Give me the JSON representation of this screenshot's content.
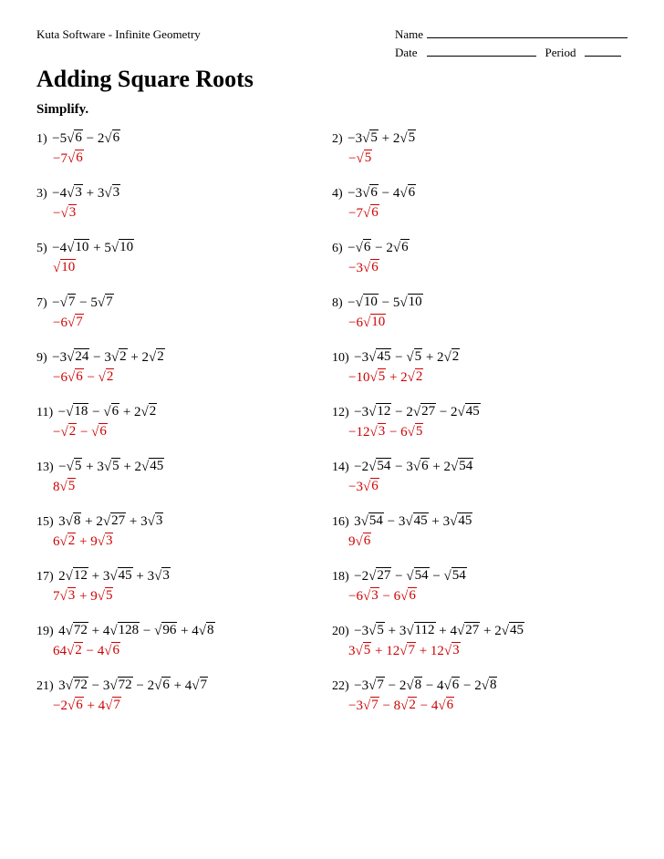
{
  "header": {
    "software": "Kuta Software - Infinite Geometry",
    "name_label": "Name",
    "date_label": "Date",
    "period_label": "Period"
  },
  "title": "Adding Square Roots",
  "instruction": "Simplify.",
  "problems": [
    {
      "num": "1)",
      "expr_html": "&minus;5&radic;<span class='rad-content'>6</span> &minus; 2&radic;<span class='rad-content'>6</span>",
      "answer_html": "&minus;7&radic;<span class='rad-content'>6</span>"
    },
    {
      "num": "2)",
      "expr_html": "&minus;3&radic;<span class='rad-content'>5</span> + 2&radic;<span class='rad-content'>5</span>",
      "answer_html": "&minus;&radic;<span class='rad-content'>5</span>"
    },
    {
      "num": "3)",
      "expr_html": "&minus;4&radic;<span class='rad-content'>3</span> + 3&radic;<span class='rad-content'>3</span>",
      "answer_html": "&minus;&radic;<span class='rad-content'>3</span>"
    },
    {
      "num": "4)",
      "expr_html": "&minus;3&radic;<span class='rad-content'>6</span> &minus; 4&radic;<span class='rad-content'>6</span>",
      "answer_html": "&minus;7&radic;<span class='rad-content'>6</span>"
    },
    {
      "num": "5)",
      "expr_html": "&minus;4&radic;<span class='rad-content'>10</span> + 5&radic;<span class='rad-content'>10</span>",
      "answer_html": "&radic;<span class='rad-content'>10</span>"
    },
    {
      "num": "6)",
      "expr_html": "&minus;&radic;<span class='rad-content'>6</span> &minus; 2&radic;<span class='rad-content'>6</span>",
      "answer_html": "&minus;3&radic;<span class='rad-content'>6</span>"
    },
    {
      "num": "7)",
      "expr_html": "&minus;&radic;<span class='rad-content'>7</span> &minus; 5&radic;<span class='rad-content'>7</span>",
      "answer_html": "&minus;6&radic;<span class='rad-content'>7</span>"
    },
    {
      "num": "8)",
      "expr_html": "&minus;&radic;<span class='rad-content'>10</span> &minus; 5&radic;<span class='rad-content'>10</span>",
      "answer_html": "&minus;6&radic;<span class='rad-content'>10</span>"
    },
    {
      "num": "9)",
      "expr_html": "&minus;3&radic;<span class='rad-content'>24</span> &minus; 3&radic;<span class='rad-content'>2</span> + 2&radic;<span class='rad-content'>2</span>",
      "answer_html": "&minus;6&radic;<span class='rad-content'>6</span> &minus; &radic;<span class='rad-content'>2</span>"
    },
    {
      "num": "10)",
      "expr_html": "&minus;3&radic;<span class='rad-content'>45</span> &minus; &radic;<span class='rad-content'>5</span> + 2&radic;<span class='rad-content'>2</span>",
      "answer_html": "&minus;10&radic;<span class='rad-content'>5</span> + 2&radic;<span class='rad-content'>2</span>"
    },
    {
      "num": "11)",
      "expr_html": "&minus;&radic;<span class='rad-content'>18</span> &minus; &radic;<span class='rad-content'>6</span> + 2&radic;<span class='rad-content'>2</span>",
      "answer_html": "&minus;&radic;<span class='rad-content'>2</span> &minus; &radic;<span class='rad-content'>6</span>"
    },
    {
      "num": "12)",
      "expr_html": "&minus;3&radic;<span class='rad-content'>12</span> &minus; 2&radic;<span class='rad-content'>27</span> &minus; 2&radic;<span class='rad-content'>45</span>",
      "answer_html": "&minus;12&radic;<span class='rad-content'>3</span> &minus; 6&radic;<span class='rad-content'>5</span>"
    },
    {
      "num": "13)",
      "expr_html": "&minus;&radic;<span class='rad-content'>5</span> + 3&radic;<span class='rad-content'>5</span> + 2&radic;<span class='rad-content'>45</span>",
      "answer_html": "8&radic;<span class='rad-content'>5</span>"
    },
    {
      "num": "14)",
      "expr_html": "&minus;2&radic;<span class='rad-content'>54</span> &minus; 3&radic;<span class='rad-content'>6</span> + 2&radic;<span class='rad-content'>54</span>",
      "answer_html": "&minus;3&radic;<span class='rad-content'>6</span>"
    },
    {
      "num": "15)",
      "expr_html": "3&radic;<span class='rad-content'>8</span> + 2&radic;<span class='rad-content'>27</span> + 3&radic;<span class='rad-content'>3</span>",
      "answer_html": "6&radic;<span class='rad-content'>2</span> + 9&radic;<span class='rad-content'>3</span>"
    },
    {
      "num": "16)",
      "expr_html": "3&radic;<span class='rad-content'>54</span> &minus; 3&radic;<span class='rad-content'>45</span> + 3&radic;<span class='rad-content'>45</span>",
      "answer_html": "9&radic;<span class='rad-content'>6</span>"
    },
    {
      "num": "17)",
      "expr_html": "2&radic;<span class='rad-content'>12</span> + 3&radic;<span class='rad-content'>45</span> + 3&radic;<span class='rad-content'>3</span>",
      "answer_html": "7&radic;<span class='rad-content'>3</span> + 9&radic;<span class='rad-content'>5</span>"
    },
    {
      "num": "18)",
      "expr_html": "&minus;2&radic;<span class='rad-content'>27</span> &minus; &radic;<span class='rad-content'>54</span> &minus; &radic;<span class='rad-content'>54</span>",
      "answer_html": "&minus;6&radic;<span class='rad-content'>3</span> &minus; 6&radic;<span class='rad-content'>6</span>"
    },
    {
      "num": "19)",
      "expr_html": "4&radic;<span class='rad-content'>72</span> + 4&radic;<span class='rad-content'>128</span> &minus; &radic;<span class='rad-content'>96</span> + 4&radic;<span class='rad-content'>8</span>",
      "answer_html": "64&radic;<span class='rad-content'>2</span> &minus; 4&radic;<span class='rad-content'>6</span>"
    },
    {
      "num": "20)",
      "expr_html": "&minus;3&radic;<span class='rad-content'>5</span> + 3&radic;<span class='rad-content'>112</span> + 4&radic;<span class='rad-content'>27</span> + 2&radic;<span class='rad-content'>45</span>",
      "answer_html": "3&radic;<span class='rad-content'>5</span> + 12&radic;<span class='rad-content'>7</span> + 12&radic;<span class='rad-content'>3</span>"
    },
    {
      "num": "21)",
      "expr_html": "3&radic;<span class='rad-content'>72</span> &minus; 3&radic;<span class='rad-content'>72</span> &minus; 2&radic;<span class='rad-content'>6</span> + 4&radic;<span class='rad-content'>7</span>",
      "answer_html": "&minus;2&radic;<span class='rad-content'>6</span> + 4&radic;<span class='rad-content'>7</span>"
    },
    {
      "num": "22)",
      "expr_html": "&minus;3&radic;<span class='rad-content'>7</span> &minus; 2&radic;<span class='rad-content'>8</span> &minus; 4&radic;<span class='rad-content'>6</span> &minus; 2&radic;<span class='rad-content'>8</span>",
      "answer_html": "&minus;3&radic;<span class='rad-content'>7</span> &minus; 8&radic;<span class='rad-content'>2</span> &minus; 4&radic;<span class='rad-content'>6</span>"
    }
  ]
}
